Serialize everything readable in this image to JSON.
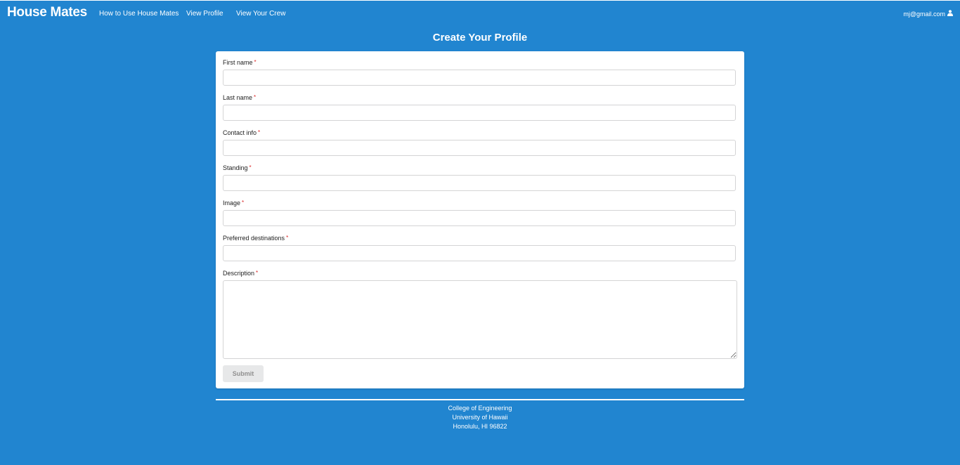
{
  "navbar": {
    "brand": "House Mates",
    "items": [
      {
        "label": "How to Use House Mates"
      },
      {
        "label": "View Profile"
      },
      {
        "label": "View Your Crew"
      }
    ],
    "user_email": "mj@gmail.com",
    "user_icon": "user-icon"
  },
  "page": {
    "title": "Create Your Profile"
  },
  "form": {
    "required_marker": "*",
    "fields": [
      {
        "label": "First name",
        "value": ""
      },
      {
        "label": "Last name",
        "value": ""
      },
      {
        "label": "Contact info",
        "value": ""
      },
      {
        "label": "Standing",
        "value": ""
      },
      {
        "label": "Image",
        "value": ""
      },
      {
        "label": "Preferred destinations",
        "value": ""
      },
      {
        "label": "Description",
        "value": ""
      }
    ],
    "submit_label": "Submit"
  },
  "footer": {
    "line1": "College of Engineering",
    "line2": "University of Hawaii",
    "line3": "Honolulu, HI 96822"
  },
  "colors": {
    "background": "#2185d0",
    "card": "#ffffff",
    "required": "#db2828"
  }
}
